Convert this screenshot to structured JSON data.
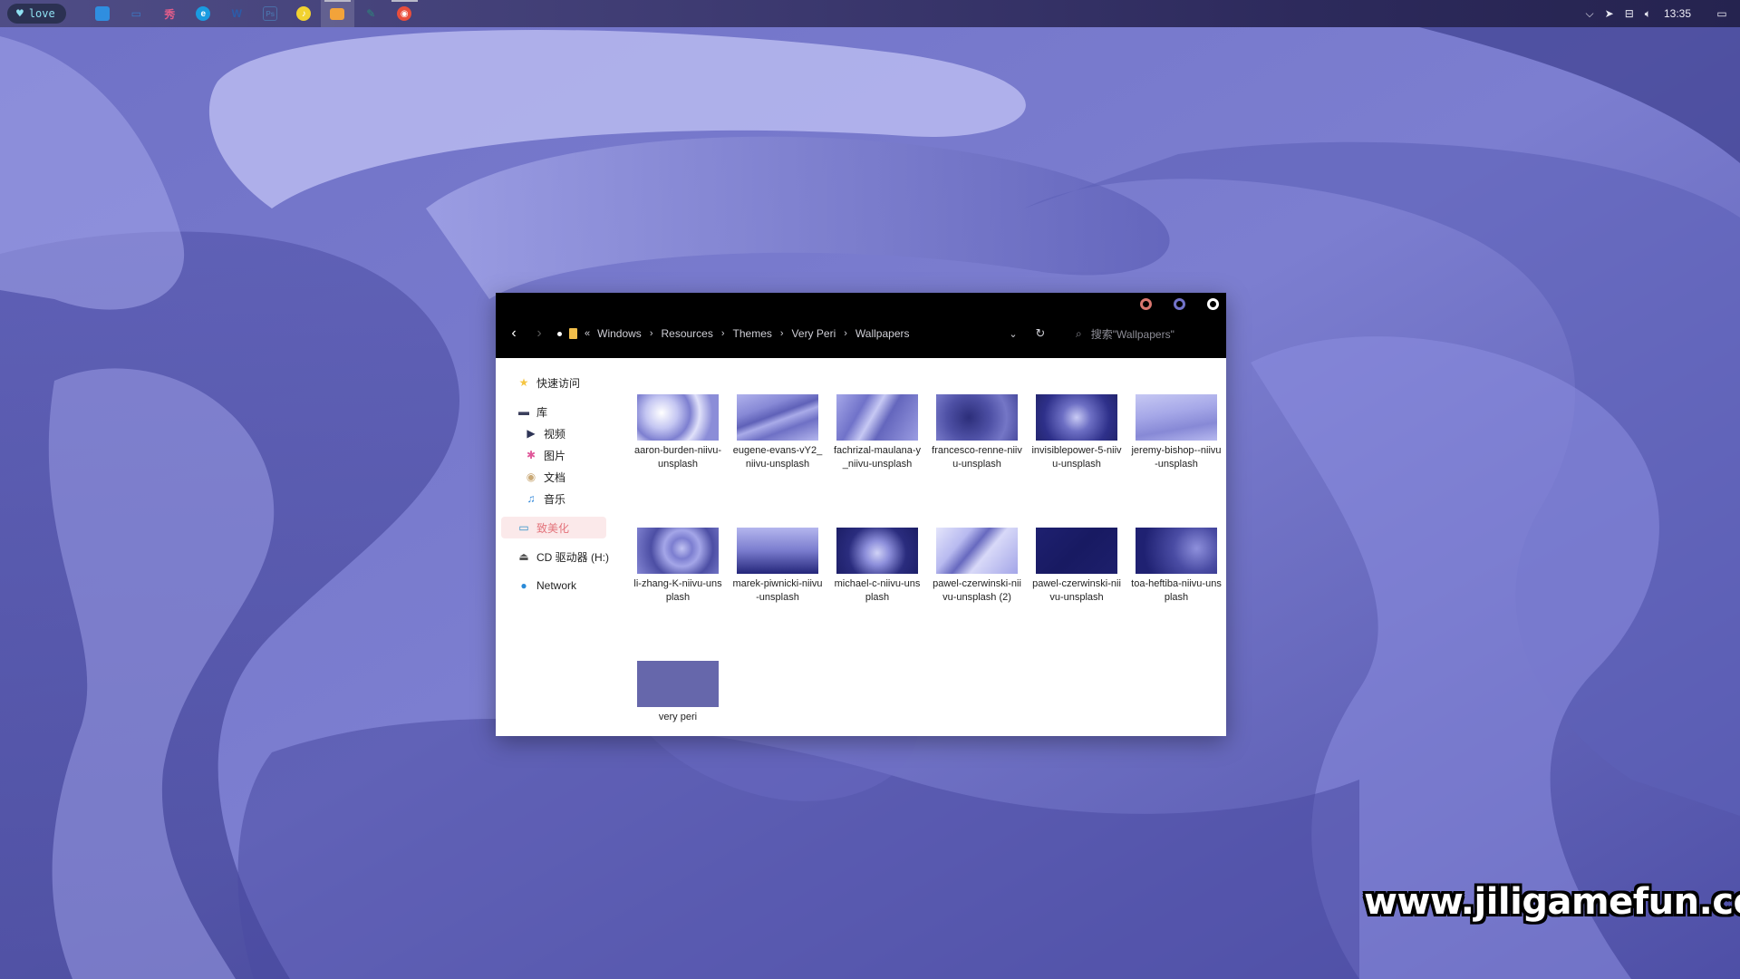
{
  "taskbar": {
    "badge": {
      "icon": "heart-icon",
      "label": "love"
    },
    "apps": [
      {
        "name": "start",
        "icon": "windows-start-icon",
        "glyph": "■",
        "color": "#2f8ee0",
        "running": false,
        "active": false
      },
      {
        "name": "task-view",
        "icon": "window-icon",
        "glyph": "▭",
        "color": "#3a7bc8",
        "running": false,
        "active": false
      },
      {
        "name": "xiu-app",
        "icon": "xiu-icon",
        "glyph": "秀",
        "color": "#e25d8a",
        "running": false,
        "active": false
      },
      {
        "name": "edge",
        "icon": "edge-browser-icon",
        "glyph": "e",
        "color": "#1a9be0",
        "running": false,
        "active": false
      },
      {
        "name": "word",
        "icon": "word-icon",
        "glyph": "W",
        "color": "#2b5caa",
        "running": false,
        "active": false
      },
      {
        "name": "photoshop",
        "icon": "photoshop-icon",
        "glyph": "Ps",
        "color": "#4a6fa8",
        "running": false,
        "active": false
      },
      {
        "name": "qq-music",
        "icon": "music-app-icon",
        "glyph": "♪",
        "color": "#f2d230",
        "running": false,
        "active": false
      },
      {
        "name": "file-explorer",
        "icon": "folder-icon",
        "glyph": "▬",
        "color": "#f2a33a",
        "running": true,
        "active": true
      },
      {
        "name": "notes",
        "icon": "notes-icon",
        "glyph": "✎",
        "color": "#2b8a7a",
        "running": false,
        "active": false
      },
      {
        "name": "chrome",
        "icon": "chrome-icon",
        "glyph": "◉",
        "color": "#e94e3c",
        "running": true,
        "active": false
      }
    ],
    "tray": {
      "overflow_icon": "chevron-up-icon",
      "time": "13:35"
    }
  },
  "explorer": {
    "breadcrumb": [
      "Windows",
      "Resources",
      "Themes",
      "Very Peri",
      "Wallpapers"
    ],
    "search_placeholder": "搜索\"Wallpapers\"",
    "colors": {
      "min": "#d9766f",
      "max": "#7273c9",
      "close": "#ffffff",
      "selected_bg": "#fbe9ea",
      "selected_fg": "#e3727a"
    },
    "sidebar": [
      {
        "label": "快速访问",
        "icon": "star-icon"
      },
      {
        "label": "库",
        "icon": "library-folder-icon"
      },
      {
        "label": "视频",
        "icon": "video-icon"
      },
      {
        "label": "图片",
        "icon": "pictures-icon"
      },
      {
        "label": "文档",
        "icon": "documents-icon"
      },
      {
        "label": "音乐",
        "icon": "music-icon"
      },
      {
        "label": "致美化",
        "icon": "monitor-icon"
      },
      {
        "label": "CD 驱动器 (H:)",
        "icon": "cd-drive-icon"
      },
      {
        "label": "Network",
        "icon": "network-icon"
      }
    ],
    "files": [
      {
        "name": "aaron-burden-niivu-unsplash",
        "thumb": "light"
      },
      {
        "name": "eugene-evans-vY2_niivu-unsplash",
        "thumb": "waves"
      },
      {
        "name": "fachrizal-maulana-y_niivu-unsplash",
        "thumb": "ribbon"
      },
      {
        "name": "francesco-renne-niivu-unsplash",
        "thumb": "texture"
      },
      {
        "name": "invisiblepower-5-niivu-unsplash",
        "thumb": "burst"
      },
      {
        "name": "jeremy-bishop--niivu-unsplash",
        "thumb": "dunes"
      },
      {
        "name": "li-zhang-K-niivu-unsplash",
        "thumb": "swirl"
      },
      {
        "name": "marek-piwnicki-niivu-unsplash",
        "thumb": "fade"
      },
      {
        "name": "michael-c-niivu-unsplash",
        "thumb": "flower"
      },
      {
        "name": "pawel-czerwinski-niivu-unsplash (2)",
        "thumb": "marble"
      },
      {
        "name": "pawel-czerwinski-niivu-unsplash",
        "thumb": "dark"
      },
      {
        "name": "toa-heftiba-niivu-unsplash",
        "thumb": "glow"
      },
      {
        "name": "very peri",
        "thumb": "solid"
      }
    ]
  },
  "watermark": "www.jiligamefun.com"
}
